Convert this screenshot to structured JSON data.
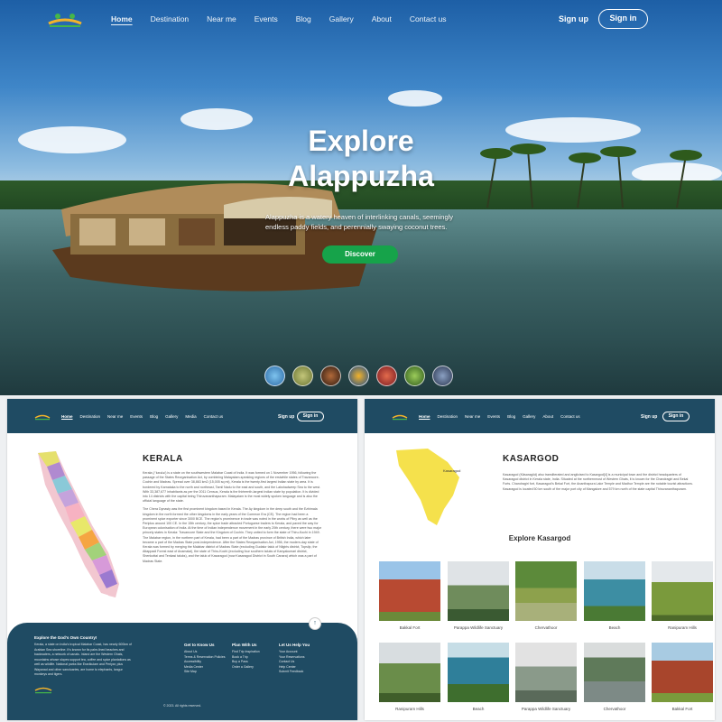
{
  "hero": {
    "nav": {
      "links": [
        "Home",
        "Destination",
        "Near me",
        "Events",
        "Blog",
        "Gallery",
        "About",
        "Contact us"
      ],
      "signup": "Sign up",
      "signin": "Sign in"
    },
    "title_line1": "Explore",
    "title_line2": "Alappuzha",
    "subtitle": "Alappuzha is a watery heaven of interlinking canals, seemingly endless paddy fields, and perennially swaying coconut trees.",
    "cta": "Discover",
    "thumb_colors": [
      "#3d8bd6",
      "#8c9a50",
      "#5a3b2c",
      "#2563a8",
      "#b8343a",
      "#4d7a2a",
      "#3a4e6d"
    ]
  },
  "kerala_page": {
    "nav": {
      "links": [
        "Home",
        "Destination",
        "Near me",
        "Events",
        "Blog",
        "Gallery",
        "Media",
        "Contact us"
      ],
      "signup": "Sign up",
      "signin": "Sign in"
    },
    "title": "KERALA",
    "para1": "Kerala (/ˈkɛrələ/) is a state on the southwestern Malabar Coast of India. It was formed on 1 November 1956, following the passage of the States Reorganisation Act, by combining Malayalam-speaking regions of the erstwhile states of Travancore-Cochin and Madras. Spread over 38,863 km2 (15,005 sq mi), Kerala is the twenty-first largest Indian state by area. It is bordered by Karnataka to the north and northeast, Tamil Nadu to the east and south, and the Lakshadweep Sea to the west. With 33,387,677 inhabitants as per the 2011 Census, Kerala is the thirteenth-largest Indian state by population. It is divided into 14 districts with the capital being Thiruvananthapuram. Malayalam is the most widely spoken language and is also the official language of the state.",
    "para2": "The Chera Dynasty was the first prominent kingdom based in Kerala. The Ay kingdom in the deep south and the Ezhimala kingdom in the north formed the other kingdoms in the early years of the Common Era (CE). The region had been a prominent spice exporter since 3000 BCE. The region's prominence in trade was noted in the works of Pliny as well as the Periplus around 100 CE. In the 15th century, the spice trade attracted Portuguese traders to Kerala, and paved the way for European colonisation of India. At the time of Indian independence movement in the early 20th century, there were two major princely states in Kerala: Travancore State and the Kingdom of Cochin. They united to form the state of Thiru-Kochi in 1949. The Malabar region, in the northern part of Kerala, had been a part of the Madras province of British India, which later became a part of the Madras State post-independence. After the States Reorganisation Act, 1956, the modern-day state of Kerala was formed by merging the Malabar district of Madras State (excluding Gudalur taluk of Nilgiris district, Topslip, the Attappadi Forest east of Anamalai), the state of Thiru-Kochi (excluding four southern taluks of Kanyakumari district, Shenkottai and Tenkasi taluks), and the taluk of Kasaragod (now Kasaragod District in South Canara) which was a part of Madras State.",
    "footer": {
      "heading": "Explore the God's Own Country!",
      "about": "Kerala, a state on India's tropical Malabar Coast, has nearly 600km of Arabian Sea shoreline. It's known for its palm-lined beaches and backwaters, a network of canals. Inland are the Western Ghats, mountains whose slopes support tea, coffee and spice plantations as well as wildlife. National parks like Eravikulam and Periyar, plus Wayanad and other sanctuaries, are home to elephants, langur monkeys and tigers.",
      "col1_title": "Get to Know Us",
      "col1": [
        "About Us",
        "Terms & Reservation Policies",
        "Accessibility",
        "Media Center",
        "Site Map"
      ],
      "col2_title": "Plan With Us",
      "col2": [
        "Find Trip Inspiration",
        "Book a Trip",
        "Buy a Pass",
        "Order a Gallery"
      ],
      "col3_title": "Let Us Help You",
      "col3": [
        "Your Account",
        "Your Reservations",
        "Contact Us",
        "Help Center",
        "Submit Feedback"
      ],
      "copyright": "© 2023. All rights reserved.",
      "top": "↑"
    }
  },
  "kasargod_page": {
    "nav": {
      "links": [
        "Home",
        "Destination",
        "Near me",
        "Events",
        "Blog",
        "Gallery",
        "About",
        "Contact us"
      ],
      "signup": "Sign up",
      "signin": "Sign in"
    },
    "title": "KASARGOD",
    "map_label": "Kasaragod",
    "para": "Kasaragod (Kāsaragōḍ) also transliterated and anglicised to Kasargod[4] is a municipal town and the district headquarters of Kasaragod district in Kerala state, India. Situated at the northernmost of Western Ghats, it is known for the Chandragiri and Bekal Forts. Chandragiri fort, Kasaragod's Bekal Fort, the Ananthapura Lake Temple and Madhur Temple are the notable tourist attractions. Kasaragod is located 50 km south of the major port city of Mangalore and 579 km north of the state capital Thiruvananthapuram.",
    "explore_title": "Explore Kasargod",
    "gallery": [
      {
        "label": "Bakkal Fort",
        "color": "#b84a32"
      },
      {
        "label": "Parappa Wildlife Sanctuary",
        "color": "#6f8c5c"
      },
      {
        "label": "Chervathoor",
        "color": "#8da14c"
      },
      {
        "label": "Beach",
        "color": "#3d8ea3"
      },
      {
        "label": "Ranipuram Hills",
        "color": "#7a9a3c"
      },
      {
        "label": "Ranipuram Hills",
        "color": "#6a8d4a"
      },
      {
        "label": "Beach",
        "color": "#2f7f9a"
      },
      {
        "label": "Parappa Wildlife Sanctuary",
        "color": "#8a9a8a"
      },
      {
        "label": "Chervathoor",
        "color": "#5f7a5a"
      },
      {
        "label": "Bakkal Fort",
        "color": "#a8452c"
      }
    ]
  }
}
